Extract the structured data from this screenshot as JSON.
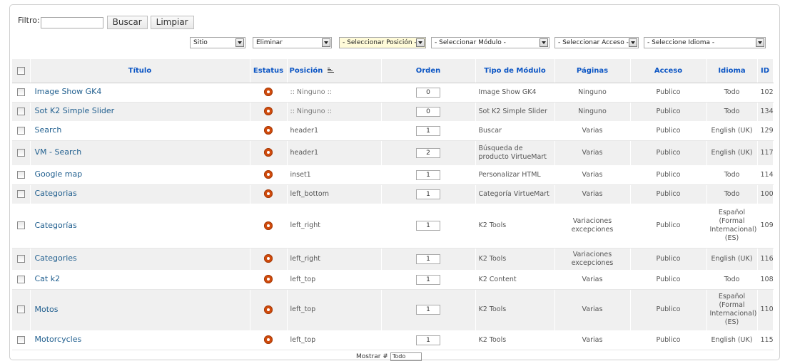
{
  "filter": {
    "label": "Filtro:",
    "value": "",
    "search_button": "Buscar",
    "clear_button": "Limpiar"
  },
  "selects": {
    "site": "Sitio",
    "state": "Eliminar",
    "position": "- Seleccionar Posición -",
    "module": "- Seleccionar Módulo -",
    "access": "- Seleccionar Acceso -",
    "language": "- Seleccione Idioma -"
  },
  "table": {
    "headers": {
      "title": "Título",
      "status": "Estatus",
      "position": "Posición",
      "order": "Orden",
      "module_type": "Tipo de Módulo",
      "pages": "Páginas",
      "access": "Acceso",
      "language": "Idioma",
      "id": "ID"
    },
    "rows": [
      {
        "title": "Image Show GK4",
        "position": ":: Ninguno ::",
        "order": "0",
        "type": "Image Show GK4",
        "pages": "Ninguno",
        "access": "Publico",
        "language": "Todo",
        "id": "102"
      },
      {
        "title": "Sot K2 Simple Slider",
        "position": ":: Ninguno ::",
        "order": "0",
        "type": "Sot K2 Simple Slider",
        "pages": "Ninguno",
        "access": "Publico",
        "language": "Todo",
        "id": "134"
      },
      {
        "title": "Search",
        "position": "header1",
        "order": "1",
        "type": "Buscar",
        "pages": "Varias",
        "access": "Publico",
        "language": "English (UK)",
        "id": "129"
      },
      {
        "title": "VM - Search",
        "position": "header1",
        "order": "2",
        "type": "Búsqueda de producto VirtueMart",
        "pages": "Varias",
        "access": "Publico",
        "language": "English (UK)",
        "id": "117"
      },
      {
        "title": "Google map",
        "position": "inset1",
        "order": "1",
        "type": "Personalizar HTML",
        "pages": "Varias",
        "access": "Publico",
        "language": "Todo",
        "id": "114"
      },
      {
        "title": "Categorias",
        "position": "left_bottom",
        "order": "1",
        "type": "Categoría VirtueMart",
        "pages": "Varias",
        "access": "Publico",
        "language": "Todo",
        "id": "100"
      },
      {
        "title": "Categorías",
        "position": "left_right",
        "order": "1",
        "type": "K2 Tools",
        "pages": "Variaciones excepciones",
        "access": "Publico",
        "language": "Español (Formal Internacional) (ES)",
        "id": "109"
      },
      {
        "title": "Categories",
        "position": "left_right",
        "order": "1",
        "type": "K2 Tools",
        "pages": "Variaciones excepciones",
        "access": "Publico",
        "language": "English (UK)",
        "id": "116"
      },
      {
        "title": "Cat k2",
        "position": "left_top",
        "order": "1",
        "type": "K2 Content",
        "pages": "Varias",
        "access": "Publico",
        "language": "Todo",
        "id": "108"
      },
      {
        "title": "Motos",
        "position": "left_top",
        "order": "1",
        "type": "K2 Tools",
        "pages": "Varias",
        "access": "Publico",
        "language": "Español (Formal Internacional) (ES)",
        "id": "110"
      },
      {
        "title": "Motorcycles",
        "position": "left_top",
        "order": "1",
        "type": "K2 Tools",
        "pages": "Varias",
        "access": "Publico",
        "language": "English (UK)",
        "id": "115"
      }
    ]
  },
  "footer": {
    "display_label": "Mostrar #",
    "display_value": "Todo"
  },
  "colors": {
    "link": "#1f5e8e",
    "header_text": "#0b55c4",
    "status_published": "#d14b0c",
    "highlight_select": "#fffbd9"
  }
}
